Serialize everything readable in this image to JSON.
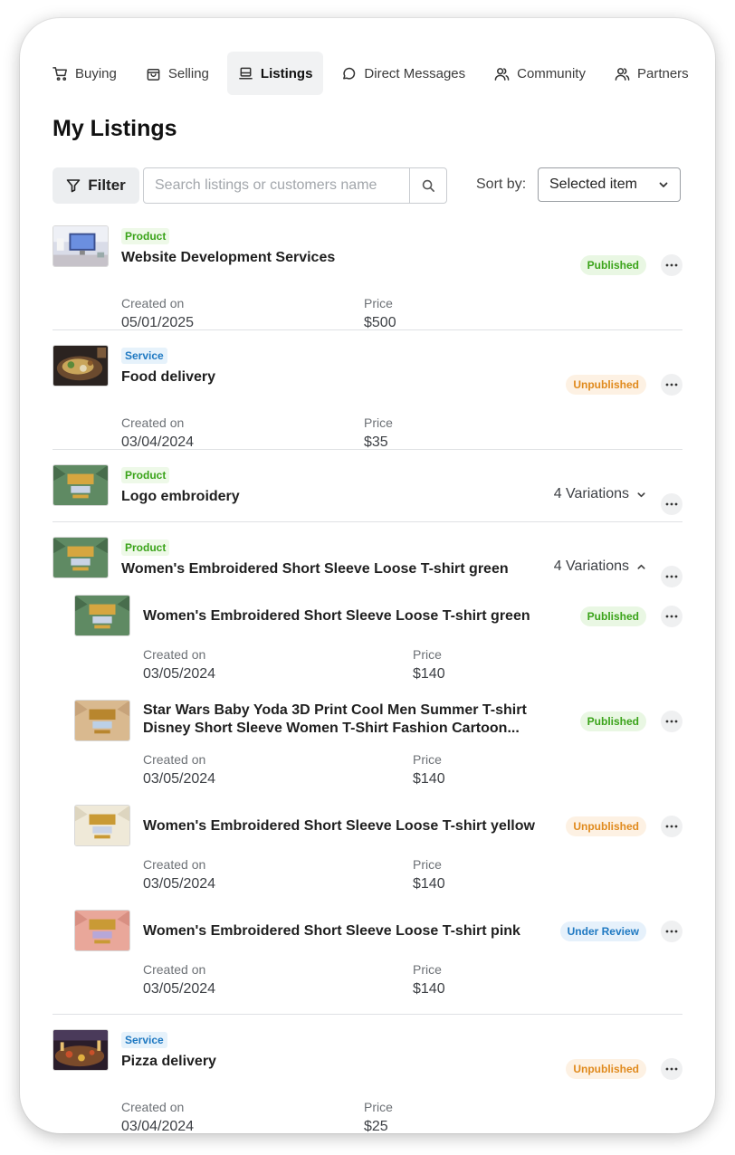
{
  "tabs": [
    {
      "label": "Buying",
      "icon": "cart-icon"
    },
    {
      "label": "Selling",
      "icon": "shopping-bag-icon"
    },
    {
      "label": "Listings",
      "icon": "listings-icon",
      "active": true
    },
    {
      "label": "Direct Messages",
      "icon": "message-icon"
    },
    {
      "label": "Community",
      "icon": "users-icon"
    },
    {
      "label": "Partners",
      "icon": "users-icon"
    }
  ],
  "page_title": "My Listings",
  "toolbar": {
    "filter_label": "Filter",
    "search_placeholder": "Search listings or customers name",
    "sort_label": "Sort by:",
    "sort_value": "Selected item"
  },
  "labels": {
    "created_on": "Created on",
    "price": "Price"
  },
  "listings": [
    {
      "type": "Product",
      "title": "Website Development Services",
      "created": "05/01/2025",
      "price": "$500",
      "status": "Published"
    },
    {
      "type": "Service",
      "title": "Food delivery",
      "created": "03/04/2024",
      "price": "$35",
      "status": "Unpublished"
    },
    {
      "type": "Product",
      "title": "Logo embroidery",
      "variations": "4 Variations"
    },
    {
      "type": "Product",
      "title": "Women's Embroidered Short Sleeve Loose T-shirt green",
      "variations": "4 Variations",
      "children": [
        {
          "title": "Women's Embroidered Short Sleeve Loose T-shirt green",
          "created": "03/05/2024",
          "price": "$140",
          "status": "Published"
        },
        {
          "title": "Star Wars Baby Yoda 3D Print Cool Men Summer T-shirt Disney Short Sleeve Women T-Shirt Fashion Cartoon...",
          "created": "03/05/2024",
          "price": "$140",
          "status": "Published"
        },
        {
          "title": "Women's Embroidered Short Sleeve Loose T-shirt yellow",
          "created": "03/05/2024",
          "price": "$140",
          "status": "Unpublished"
        },
        {
          "title": "Women's Embroidered Short Sleeve Loose T-shirt pink",
          "created": "03/05/2024",
          "price": "$140",
          "status": "Under Review"
        }
      ]
    },
    {
      "type": "Service",
      "title": "Pizza delivery",
      "created": "03/04/2024",
      "price": "$25",
      "status": "Unpublished"
    }
  ],
  "colors": {
    "published": "#3aa319",
    "unpublished": "#e08a1d",
    "review": "#1f79c2"
  }
}
